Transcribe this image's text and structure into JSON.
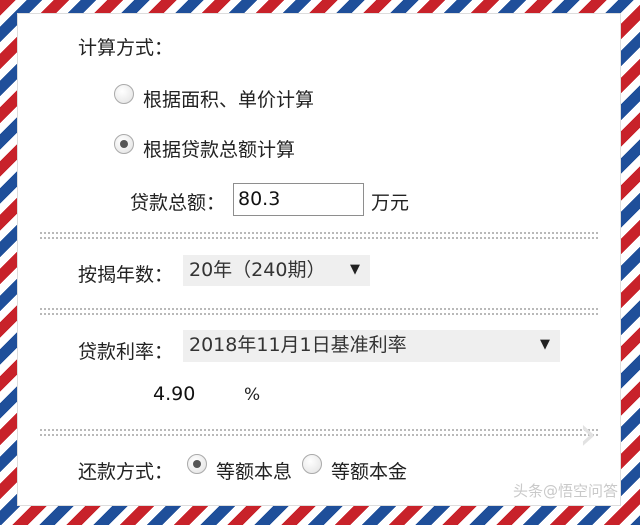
{
  "calc_method": {
    "title": "计算方式：",
    "option_area": "根据面积、单价计算",
    "option_loan": "根据贷款总额计算",
    "selected": "option_loan"
  },
  "loan_total": {
    "label": "贷款总额：",
    "value": "80.3",
    "unit": "万元"
  },
  "years": {
    "label": "按揭年数：",
    "selected": "20年（240期）"
  },
  "rate": {
    "label": "贷款利率：",
    "selected": "2018年11月1日基准利率",
    "value": "4.90",
    "unit": "%"
  },
  "repayment": {
    "label": "还款方式：",
    "option_equal_payment": "等额本息",
    "option_equal_principal": "等额本金",
    "selected": "option_equal_payment"
  },
  "watermark": "头条@悟空问答",
  "colors": {
    "border_red": "#c8222a",
    "border_blue": "#1f4f9a",
    "select_bg": "#efefef"
  }
}
